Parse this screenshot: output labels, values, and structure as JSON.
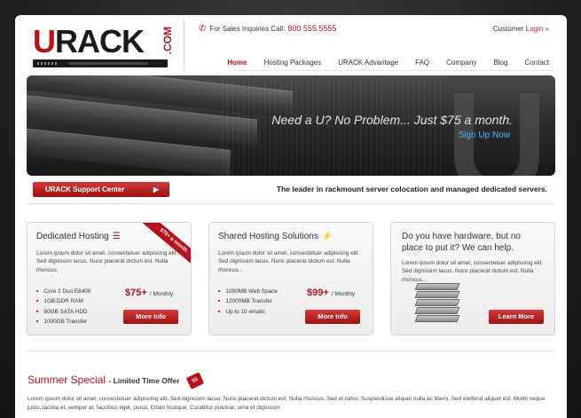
{
  "header": {
    "logo_main": "URACK",
    "logo_suffix": ".COM",
    "phone_label": "For Sales Inquiries Call:",
    "phone_number": "800 555.5555",
    "customer_label": "Customer",
    "login_label": "Login »"
  },
  "nav": {
    "items": [
      "Home",
      "Hosting Packages",
      "URACK Advantage",
      "FAQ",
      "Company",
      "Blog",
      "Contact"
    ]
  },
  "banner": {
    "headline": "Need a U? No Problem... Just $75 a month.",
    "cta": "Sign Up Now"
  },
  "support": {
    "button": "URACK Support Center",
    "arrow": "▶",
    "tagline": "The leader in rackmount server colocation and managed dedicated servers."
  },
  "boxes": {
    "dedicated": {
      "title": "Dedicated Hosting",
      "ribbon": "$75+ a month",
      "text": "Lorem ipsum dolor sit amet, consectetuer adipiscing elit. Sed dignissim lacus. Nunc placerat dictum est. Nulla rhoncus.",
      "features": [
        "Core 2 Duo E8400",
        "1GB DDR RAM",
        "80GB SATA HDD",
        "1000GB Transfer"
      ],
      "price": "$75+",
      "price_unit": "/ Monthly",
      "button": "More Info"
    },
    "shared": {
      "title": "Shared Hosting Solutions",
      "text": "Lorem ipsum dolor sit amet, consectetuer adipiscing elit. Sed dignissim lacus. Nunc placerat dictum est. Nulla rhoncus...",
      "features": [
        "1000MB Web Space",
        "12000MB Transfer",
        "Up to 10 emails"
      ],
      "price": "$99+",
      "price_unit": "/ Monthly",
      "button": "More Info"
    },
    "hardware": {
      "title": "Do you have hardware, but no place to put it? We can help.",
      "text": "Lorem ipsum dolor sit amet, consectetuer adipiscing elit. Sed dignissim lacus. Nunc placerat dictum est. Nulla rhoncus...",
      "button": "Learn More"
    }
  },
  "special": {
    "title": "Summer Special",
    "subtitle": "- Limited Time Offer",
    "tag": "$$",
    "text": "Lorem ipsum dolor sit amet, consectetuer adipiscing elit. Sed dignissim lacus. Nunc placerat dictum est. Nulla rhoncus. Sed et tortor. Suspendisse aliquet nulla ac libero. Sed eleifend aliquet est. Morbi neque justo, lacinia et, semper at, faucibus eget, purus. Etiam tristique. Curabitur pulvinar, urna et dignissim"
  },
  "colors": {
    "accent": "#b5121b",
    "link_blue": "#4db3ff",
    "background": "#1e1e1e"
  }
}
